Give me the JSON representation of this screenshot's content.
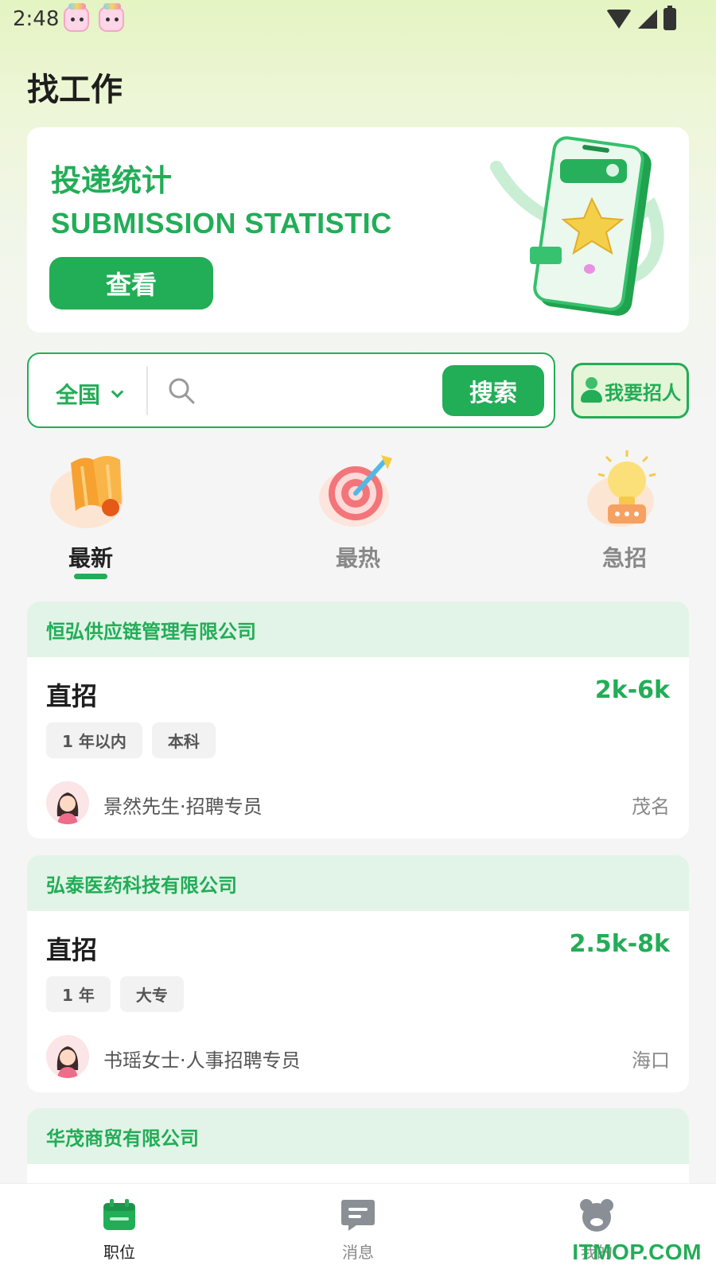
{
  "status_bar": {
    "time": "2:48"
  },
  "header": {
    "title": "找工作"
  },
  "banner": {
    "title": "投递统计",
    "subtitle": "SUBMISSION STATISTIC",
    "button_label": "查看"
  },
  "search": {
    "region": "全国",
    "placeholder": "",
    "button_label": "搜索",
    "recruit_label": "我要招人"
  },
  "categories": [
    {
      "label": "最新",
      "active": true
    },
    {
      "label": "最热",
      "active": false
    },
    {
      "label": "急招",
      "active": false
    }
  ],
  "jobs": [
    {
      "company": "恒弘供应链管理有限公司",
      "title": "直招",
      "salary": "2k-6k",
      "tags": [
        "1 年以内",
        "本科"
      ],
      "recruiter": "景然先生·招聘专员",
      "city": "茂名"
    },
    {
      "company": "弘泰医药科技有限公司",
      "title": "直招",
      "salary": "2.5k-8k",
      "tags": [
        "1 年",
        "大专"
      ],
      "recruiter": "书瑶女士·人事招聘专员",
      "city": "海口"
    },
    {
      "company": "华茂商贸有限公司"
    }
  ],
  "bottom_nav": [
    {
      "label": "职位",
      "icon": "calendar-icon",
      "active": true
    },
    {
      "label": "消息",
      "icon": "message-icon",
      "active": false
    },
    {
      "label": "我的",
      "icon": "bear-icon",
      "active": false
    }
  ],
  "watermark": "ITMOP.COM",
  "colors": {
    "accent": "#22ad57",
    "accent_light": "#e2f4e7"
  }
}
